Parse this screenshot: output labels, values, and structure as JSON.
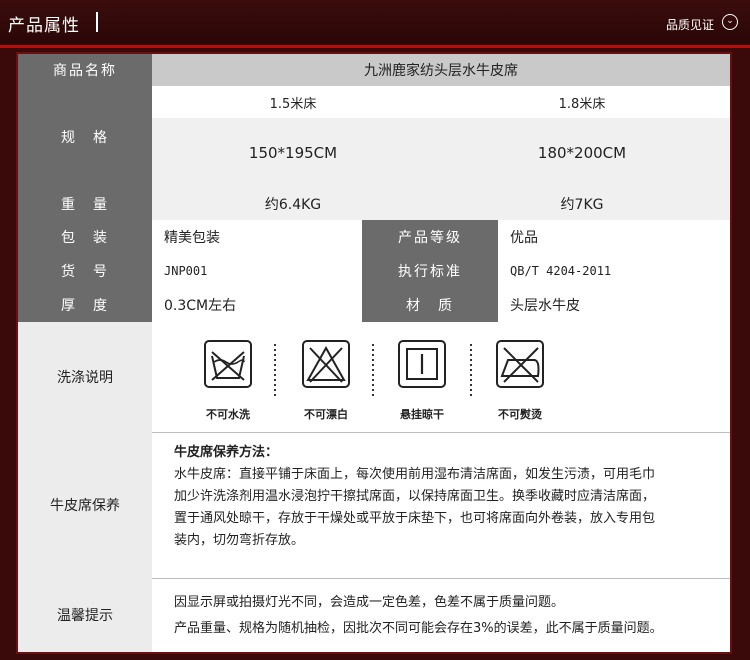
{
  "header": {
    "title": "产品属性",
    "guarantee": "品质见证"
  },
  "table": {
    "name_label": "商品名称",
    "name_value": "九洲鹿家纺头层水牛皮席",
    "spec_label": "规　格",
    "spec_col1": "1.5米床",
    "spec_col2": "1.8米床",
    "size1": "150*195CM",
    "size2": "180*200CM",
    "weight_label": "重　量",
    "weight1": "约6.4KG",
    "weight2": "约7KG",
    "pack_label": "包　装",
    "pack_value": "精美包装",
    "grade_label": "产品等级",
    "grade_value": "优品",
    "item_label": "货　号",
    "item_value": "JNP001",
    "standard_label": "执行标准",
    "standard_value": "QB/T 4204-2011",
    "thick_label": "厚　度",
    "thick_value": "0.3CM左右",
    "material_label": "材　质",
    "material_value": "头层水牛皮"
  },
  "wash": {
    "label": "洗涤说明",
    "icons": [
      {
        "icon": "no-wash-icon",
        "text": "不可水洗"
      },
      {
        "icon": "no-bleach-icon",
        "text": "不可漂白"
      },
      {
        "icon": "hang-dry-icon",
        "text": "悬挂晾干"
      },
      {
        "icon": "no-iron-icon",
        "text": "不可熨烫"
      }
    ]
  },
  "care": {
    "label": "牛皮席保养",
    "heading": "牛皮席保养方法：",
    "lines": [
      "水牛皮席：直接平铺于床面上，每次使用前用湿布清洁席面，如发生污渍，可用毛巾",
      "加少许洗涤剂用温水浸泡拧干擦拭席面，以保持席面卫生。换季收藏时应清洁席面，",
      "置于通风处晾干，存放于干燥处或平放于床垫下，也可将席面向外卷装，放入专用包",
      "装内，切勿弯折存放。"
    ]
  },
  "tips": {
    "label": "温馨提示",
    "lines": [
      "因显示屏或拍摄灯光不同，会造成一定色差，色差不属于质量问题。",
      "产品重量、规格为随机抽检，因批次不同可能会存在3%的误差，此不属于质量问题。"
    ]
  },
  "colors": {
    "accent": "#b70d0d",
    "label_bg": "#6b6b6b",
    "frame": "#3a0a0a"
  }
}
